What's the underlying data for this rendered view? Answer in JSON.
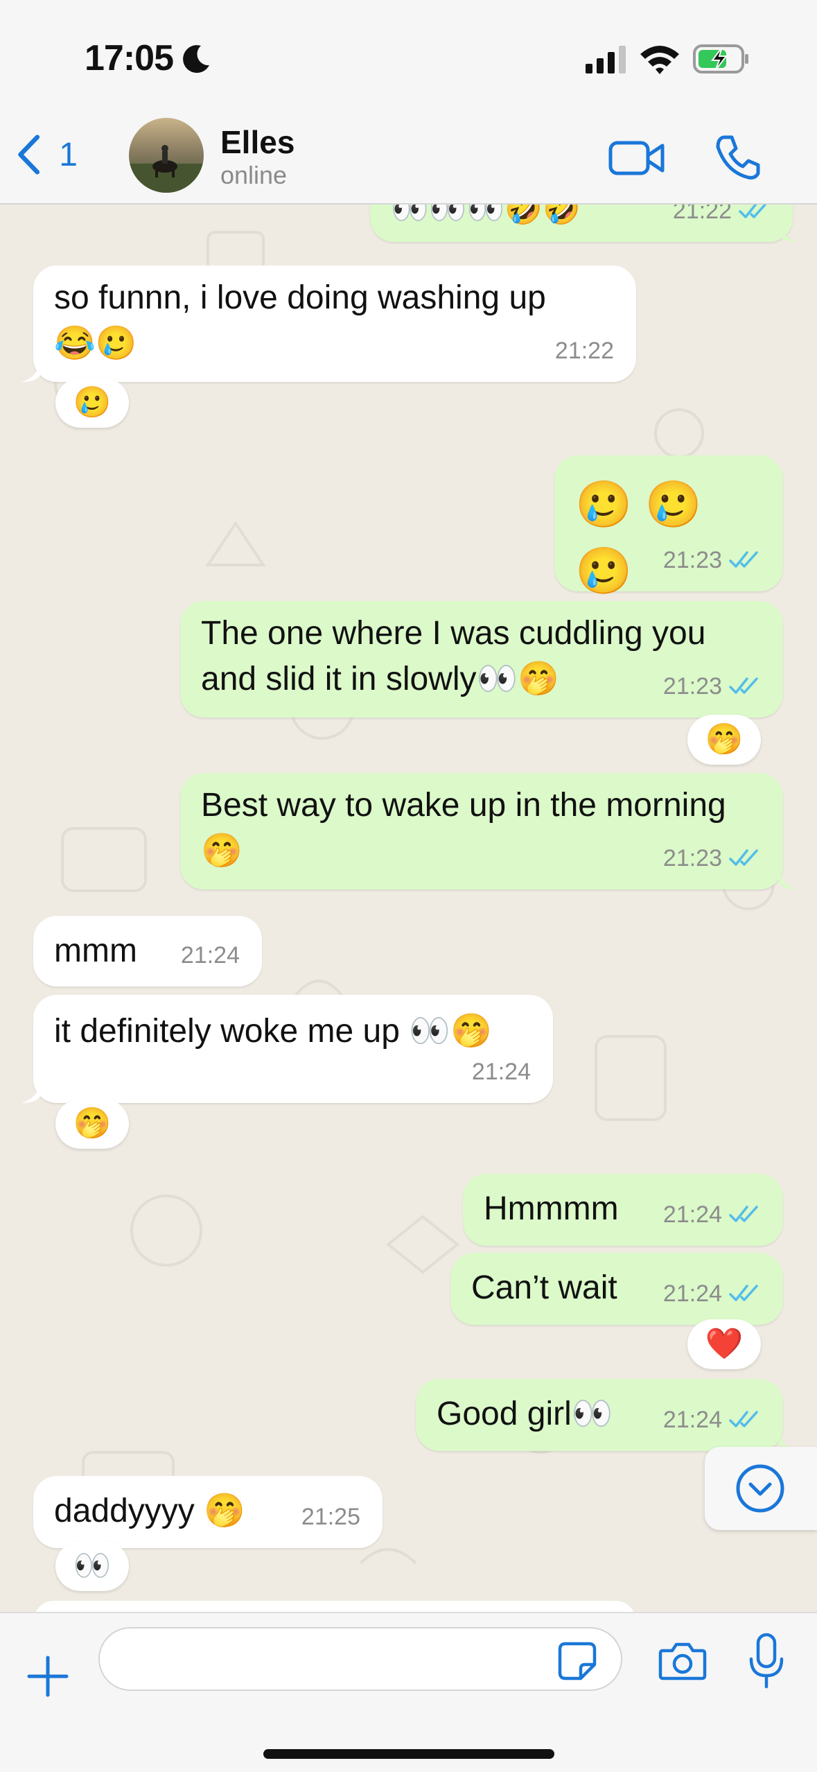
{
  "status_bar": {
    "time": "17:05"
  },
  "header": {
    "back_count": "1",
    "contact_name": "Elles",
    "contact_status": "online"
  },
  "colors": {
    "accent": "#1a77d8",
    "outgoing_bubble": "#dbf9c9",
    "incoming_bubble": "#ffffff",
    "read_tick": "#53bdeb",
    "chat_background": "#efeae2"
  },
  "messages": [
    {
      "id": "m0",
      "direction": "out",
      "text": "👀👀👀🤣🤣",
      "time": "21:22",
      "read": true
    },
    {
      "id": "m1",
      "direction": "in",
      "text": "so funnn, i love doing washing up",
      "text2": "😂🥲",
      "time": "21:22",
      "reaction": "🥲"
    },
    {
      "id": "m2",
      "direction": "out",
      "text": "🥲 🥲 🥲",
      "time": "21:23",
      "read": true
    },
    {
      "id": "m3",
      "direction": "out",
      "text": "The one where I was cuddling you",
      "text2": "and slid it in slowly👀🤭",
      "time": "21:23",
      "read": true,
      "reaction": "🤭"
    },
    {
      "id": "m4",
      "direction": "out",
      "text": "Best way to wake up in the morning",
      "text2": "🤭",
      "time": "21:23",
      "read": true
    },
    {
      "id": "m5",
      "direction": "in",
      "text": "mmm",
      "time": "21:24"
    },
    {
      "id": "m6",
      "direction": "in",
      "text": "it definitely woke me up 👀🤭",
      "time": "21:24",
      "reaction": "🤭"
    },
    {
      "id": "m7",
      "direction": "out",
      "text": "Hmmmm",
      "time": "21:24",
      "read": true
    },
    {
      "id": "m8",
      "direction": "out",
      "text": "Can’t wait",
      "time": "21:24",
      "read": true,
      "reaction": "❤️"
    },
    {
      "id": "m9",
      "direction": "out",
      "text": "Good girl👀",
      "time": "21:24",
      "read": true
    },
    {
      "id": "m10",
      "direction": "in",
      "text": "daddyyyy 🤭",
      "time": "21:25",
      "reaction": "👀"
    }
  ],
  "composer": {
    "placeholder": ""
  },
  "icons": [
    "moon-icon",
    "signal-icon",
    "wifi-icon",
    "battery-charging-icon",
    "back-chevron-icon",
    "video-call-icon",
    "phone-icon",
    "scroll-down-icon",
    "plus-icon",
    "sticker-icon",
    "camera-icon",
    "microphone-icon"
  ]
}
